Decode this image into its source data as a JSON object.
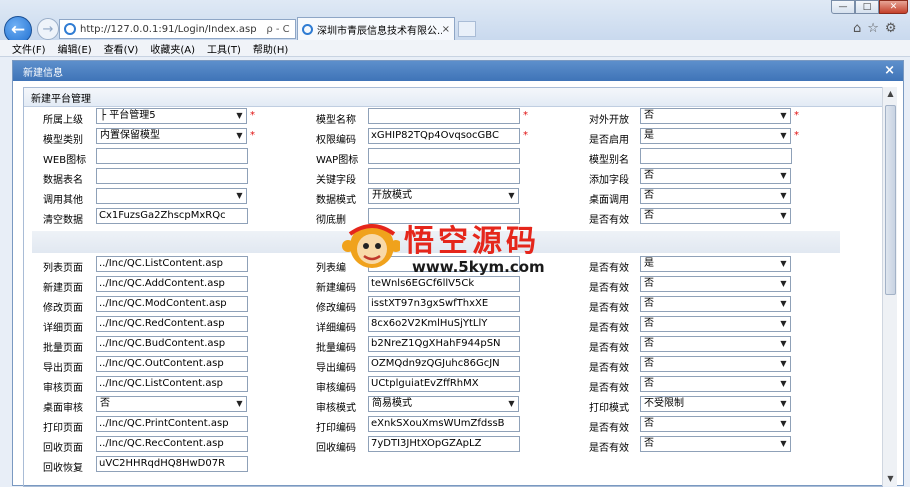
{
  "browser": {
    "url": "http://127.0.0.1:91/Login/Index.asp",
    "addr_ctl": "ρ - C",
    "tab_title": "深圳市青辰信息技术有限公...",
    "tab_close": "×",
    "menu": [
      "文件(F)",
      "编辑(E)",
      "查看(V)",
      "收藏夹(A)",
      "工具(T)",
      "帮助(H)"
    ]
  },
  "dialog": {
    "title": "新建信息",
    "close": "×",
    "panel_title": "新建平台管理"
  },
  "form": {
    "r1": {
      "l1": "所属上级",
      "v1": "├ 平台管理5",
      "l2": "模型名称",
      "v2": "",
      "l3": "对外开放",
      "v3": "否"
    },
    "r2": {
      "l1": "模型类别",
      "v1": "内置保留模型",
      "l2": "权限编码",
      "v2": "xGHIP82TQp4OvqsocGBC",
      "l3": "是否启用",
      "v3": "是"
    },
    "r3": {
      "l1": "WEB图标",
      "v1": "",
      "l2": "WAP图标",
      "v2": "",
      "l3": "模型别名",
      "v3": ""
    },
    "r4": {
      "l1": "数据表名",
      "v1": "",
      "l2": "关键字段",
      "v2": "",
      "l3": "添加字段",
      "v3": "否"
    },
    "r5": {
      "l1": "调用其他",
      "v1": "",
      "l2": "数据模式",
      "v2": "开放模式",
      "l3": "桌面调用",
      "v3": "否"
    },
    "r6": {
      "l1": "清空数据",
      "v1": "Cx1FuzsGa2ZhscpMxRQc",
      "l2": "彻底删",
      "v2": "",
      "l3": "是否有效",
      "v3": "否"
    },
    "r7": {
      "l1": "列表页面",
      "v1": "../Inc/QC.ListContent.asp",
      "l2": "列表编",
      "v2": "",
      "l3": "是否有效",
      "v3": "是"
    },
    "r8": {
      "l1": "新建页面",
      "v1": "../Inc/QC.AddContent.asp",
      "l2": "新建编码",
      "v2": "teWnls6EGCf6llV5Ck",
      "l3": "是否有效",
      "v3": "否"
    },
    "r9": {
      "l1": "修改页面",
      "v1": "../Inc/QC.ModContent.asp",
      "l2": "修改编码",
      "v2": "isstXT97n3gxSwfThxXE",
      "l3": "是否有效",
      "v3": "否"
    },
    "r10": {
      "l1": "详细页面",
      "v1": "../Inc/QC.RedContent.asp",
      "l2": "详细编码",
      "v2": "8cx6o2V2KmlHuSjYtLlY",
      "l3": "是否有效",
      "v3": "否"
    },
    "r11": {
      "l1": "批量页面",
      "v1": "../Inc/QC.BudContent.asp",
      "l2": "批量编码",
      "v2": "b2NreZ1QgXHahF944pSN",
      "l3": "是否有效",
      "v3": "否"
    },
    "r12": {
      "l1": "导出页面",
      "v1": "../Inc/QC.OutContent.asp",
      "l2": "导出编码",
      "v2": "OZMQdn9zQGJuhc86GcJN",
      "l3": "是否有效",
      "v3": "否"
    },
    "r13": {
      "l1": "审核页面",
      "v1": "../Inc/QC.ListContent.asp",
      "l2": "审核编码",
      "v2": "UCtplguiatEvZffRhMX",
      "l3": "是否有效",
      "v3": "否"
    },
    "r14": {
      "l1": "桌面审核",
      "v1": "否",
      "l2": "审核模式",
      "v2": "简易模式",
      "l3": "打印模式",
      "v3": "不受限制"
    },
    "r15": {
      "l1": "打印页面",
      "v1": "../Inc/QC.PrintContent.asp",
      "l2": "打印编码",
      "v2": "eXnkSXouXmsWUmZfdssB",
      "l3": "是否有效",
      "v3": "否"
    },
    "r16": {
      "l1": "回收页面",
      "v1": "../Inc/QC.RecContent.asp",
      "l2": "回收编码",
      "v2": "7yDTI3JHtXOpGZApLZ",
      "l3": "是否有效",
      "v3": "否"
    },
    "r17": {
      "l1": "回收恢复",
      "v1": "uVC2HHRqdHQ8HwD07R"
    }
  },
  "watermark": {
    "title": "悟空源码",
    "url": "www.5kym.com"
  }
}
